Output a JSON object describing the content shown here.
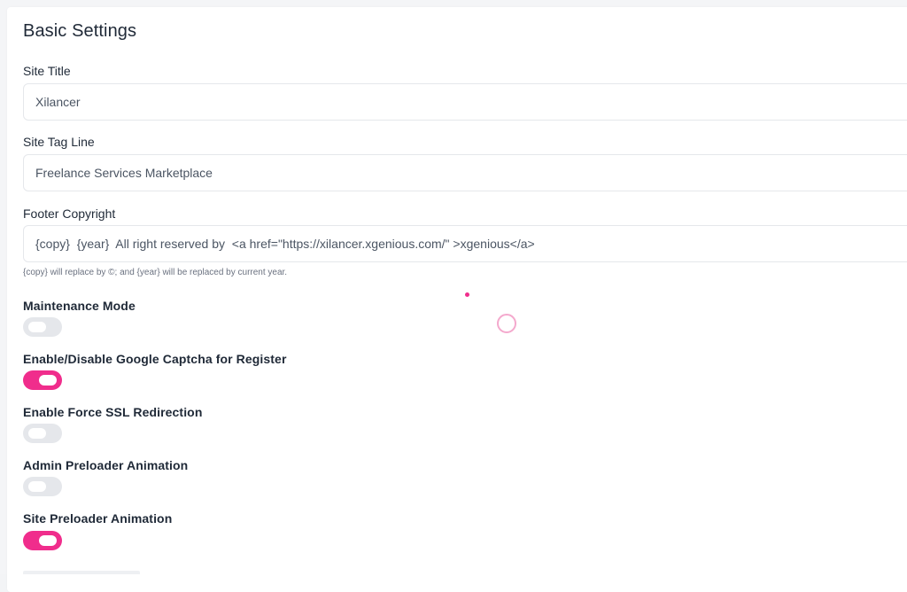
{
  "page": {
    "title": "Basic Settings"
  },
  "fields": {
    "site_title": {
      "label": "Site Title",
      "value": "Xilancer"
    },
    "site_tag_line": {
      "label": "Site Tag Line",
      "value": "Freelance Services Marketplace"
    },
    "footer_copyright": {
      "label": "Footer Copyright",
      "value": "{copy}  {year}  All right reserved by  <a href=\"https://xilancer.xgenious.com/\" >xgenious</a>",
      "help": "{copy} will replace by ©; and {year} will be replaced by current year."
    }
  },
  "toggles": [
    {
      "label": "Maintenance Mode",
      "on": false
    },
    {
      "label": "Enable/Disable Google Captcha for Register",
      "on": true
    },
    {
      "label": "Enable Force SSL Redirection",
      "on": false
    },
    {
      "label": "Admin Preloader Animation",
      "on": false
    },
    {
      "label": "Site Preloader Animation",
      "on": true
    }
  ],
  "colors": {
    "accent": "#f02d8c",
    "toggle_off": "#e5e7eb"
  }
}
